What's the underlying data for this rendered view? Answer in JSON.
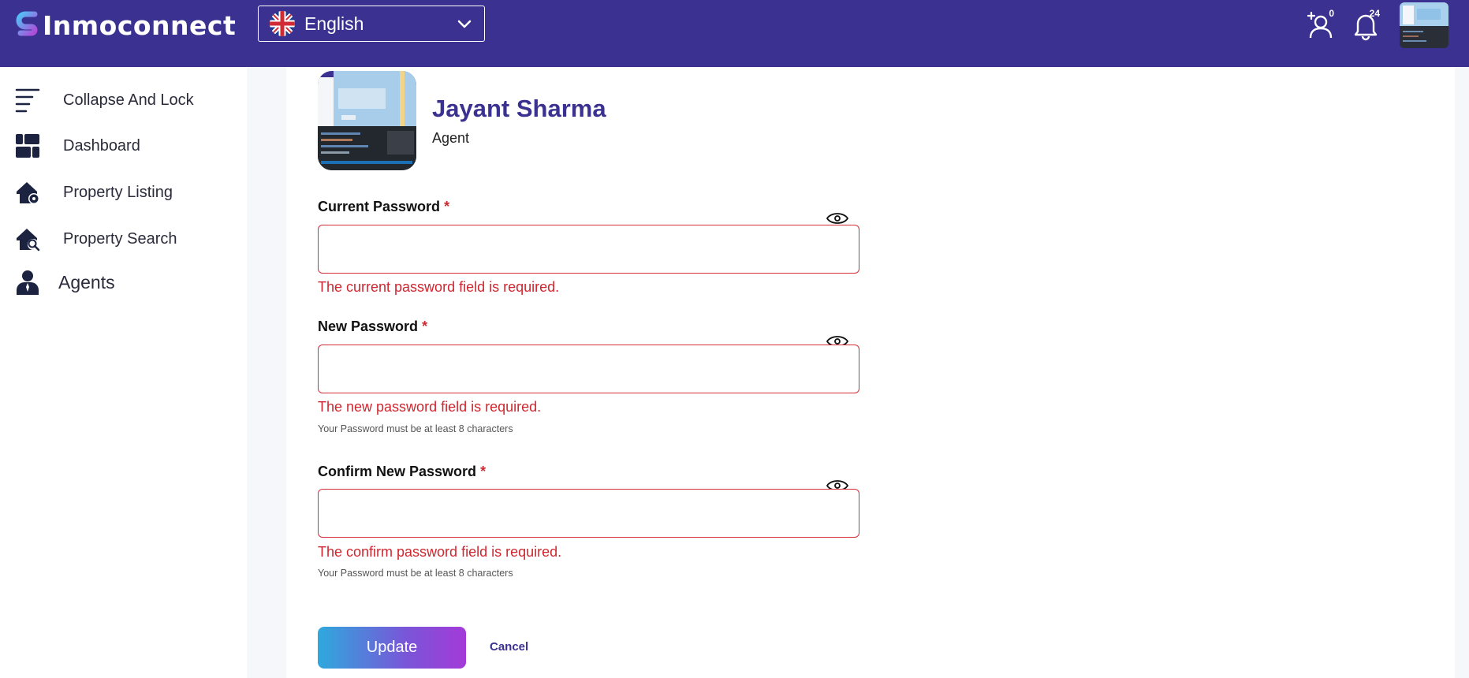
{
  "header": {
    "logo_text": "Inmoconnect",
    "language": {
      "selected": "English",
      "flag_icon": "uk-flag-icon"
    },
    "agent_requests_badge": "0",
    "notifications_badge": "24",
    "colors": {
      "bar": "#3a3190"
    }
  },
  "sidebar": {
    "items": [
      {
        "label": "Collapse And Lock",
        "icon": "menu-lines-icon"
      },
      {
        "label": "Dashboard",
        "icon": "dashboard-icon"
      },
      {
        "label": "Property Listing",
        "icon": "house-gear-icon"
      },
      {
        "label": "Property Search",
        "icon": "house-search-icon"
      },
      {
        "label": "Agents",
        "icon": "agent-person-icon"
      }
    ]
  },
  "profile": {
    "name": "Jayant Sharma",
    "role": "Agent"
  },
  "form": {
    "current": {
      "label": "Current Password",
      "required_mark": "*",
      "value": "",
      "error": "The current password field is required."
    },
    "new": {
      "label": "New Password",
      "required_mark": "*",
      "value": "",
      "error": "The new password field is required.",
      "hint": "Your Password must be at least 8 characters"
    },
    "confirm": {
      "label": "Confirm New Password",
      "required_mark": "*",
      "value": "",
      "error": "The confirm password field is required.",
      "hint": "Your Password must be at least 8 characters"
    },
    "update_label": "Update",
    "cancel_label": "Cancel"
  }
}
